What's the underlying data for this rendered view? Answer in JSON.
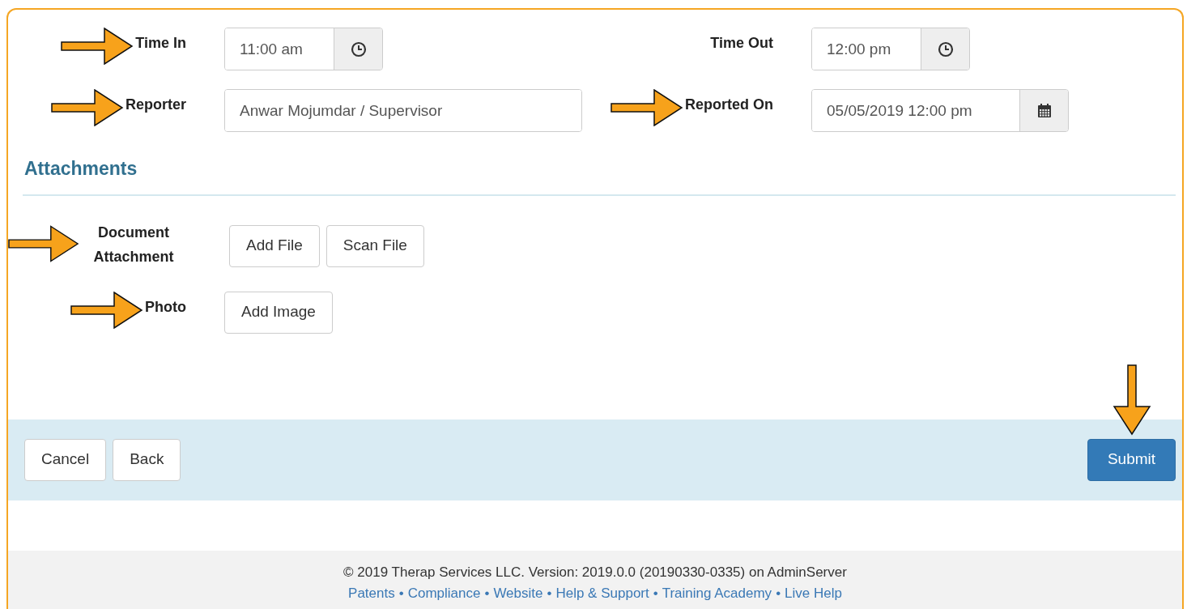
{
  "fields": [
    {
      "label": "Time In",
      "value": "11:00 am",
      "kind": "time",
      "arrow": true
    },
    {
      "label": "Time Out",
      "value": "12:00 pm",
      "kind": "time",
      "arrow": false
    },
    {
      "label": "Reporter",
      "value": "Anwar Mojumdar / Supervisor",
      "kind": "text",
      "arrow": true
    },
    {
      "label": "Reported On",
      "value": "05/05/2019 12:00 pm",
      "kind": "datetime",
      "arrow": true
    }
  ],
  "section": {
    "title": "Attachments"
  },
  "attachments": [
    {
      "label": "Document Attachment",
      "arrow": true,
      "buttons": [
        "Add File",
        "Scan File"
      ]
    },
    {
      "label": "Photo",
      "arrow": true,
      "buttons": [
        "Add Image"
      ]
    }
  ],
  "actions": {
    "left": [
      "Cancel",
      "Back"
    ],
    "submit": {
      "label": "Submit",
      "arrow": true
    }
  },
  "footer": {
    "copyright": "© 2019 Therap Services LLC. Version: 2019.0.0 (20190330-0335) on AdminServer",
    "links": [
      {
        "text": "Patents"
      },
      {
        "separator_before": "•",
        "text": "Compliance"
      },
      {
        "separator_before": "•",
        "text": "Website"
      },
      {
        "separator_before": "•",
        "text": "Help & Support"
      },
      {
        "separator_before": "•",
        "text": "Training Academy"
      },
      {
        "separator_before": "•",
        "text": "Live Help"
      }
    ]
  }
}
